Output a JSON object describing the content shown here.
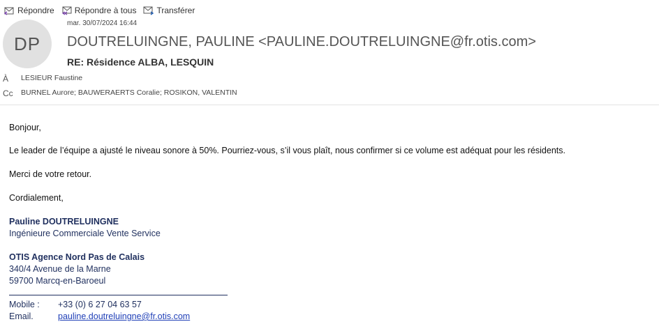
{
  "toolbar": {
    "reply": "Répondre",
    "reply_all": "Répondre à tous",
    "forward": "Transférer"
  },
  "header": {
    "avatar_initials": "DP",
    "date": "mar. 30/07/2024 16:44",
    "sender": "DOUTRELUINGNE, PAULINE <PAULINE.DOUTRELUINGNE@fr.otis.com>",
    "subject": "RE: Résidence ALBA, LESQUIN",
    "to_label": "À",
    "to": "LESIEUR Faustine",
    "cc_label": "Cc",
    "cc": "BURNEL Aurore; BAUWERAERTS Coralie; ROSIKON, VALENTIN"
  },
  "message": {
    "greeting": "Bonjour,",
    "para1": "Le leader de l’équipe a ajusté le niveau sonore à 50%. Pourriez-vous, s’il vous plaît, nous confirmer si ce volume est adéquat pour les résidents.",
    "para2": "Merci de votre retour.",
    "closing": "Cordialement,"
  },
  "signature": {
    "name": "Pauline DOUTRELUINGNE",
    "title": "Ingénieure Commerciale Vente Service",
    "company": "OTIS Agence Nord Pas de Calais",
    "address1": "340/4 Avenue de la Marne",
    "address2": "59700 Marcq-en-Baroeul",
    "mobile_label": "Mobile :",
    "mobile": "+33 (0) 6 27 04 63 57",
    "email_label": "Email.",
    "email": "pauline.doutreluingne@fr.otis.com"
  },
  "colors": {
    "signature": "#1f2f5e",
    "link": "#1f3fb7",
    "avatar_bg": "#e1e1e1"
  }
}
